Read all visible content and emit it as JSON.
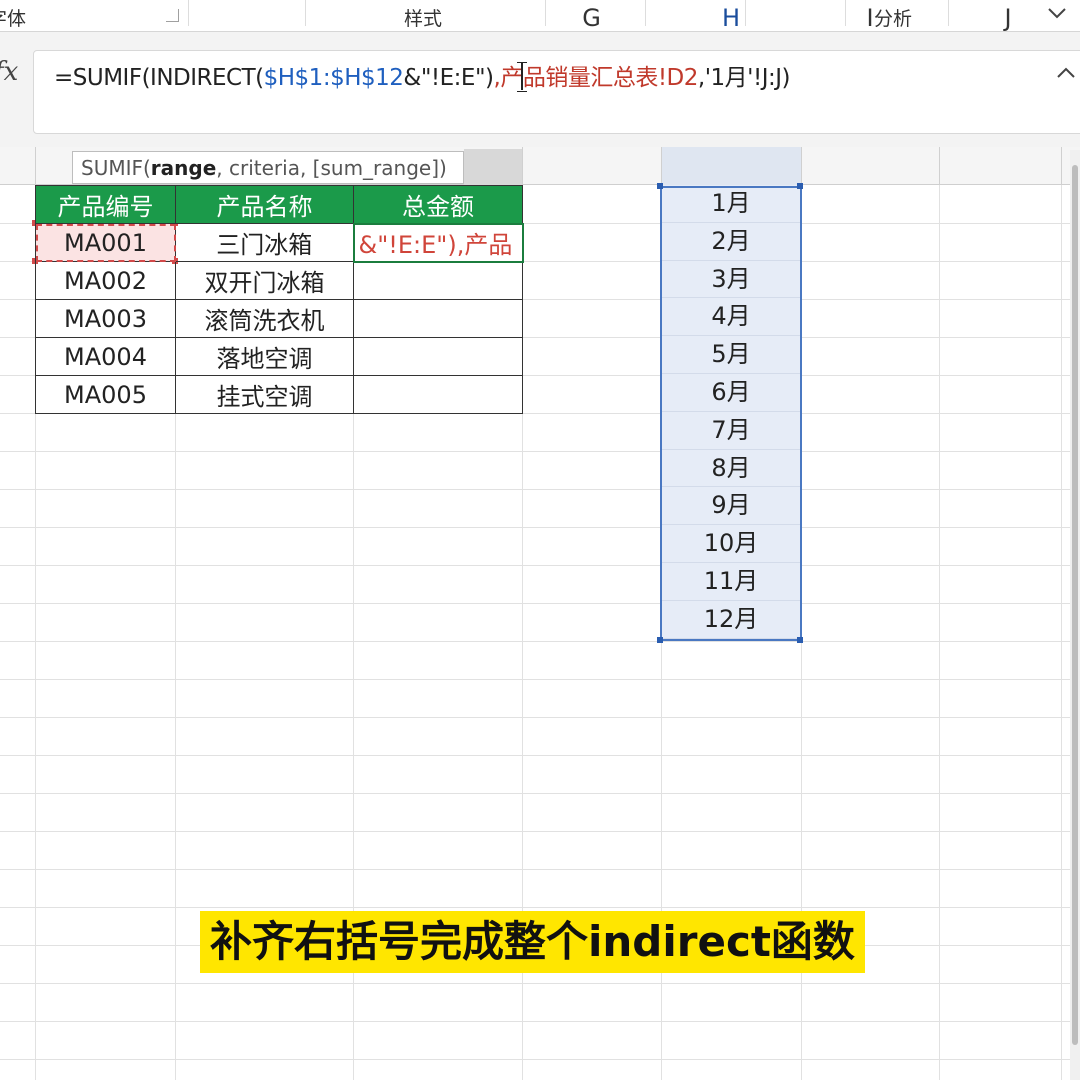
{
  "ribbon": {
    "groups": [
      "字体",
      "样式",
      "分析"
    ],
    "collapse_icon": "chevron-down-icon"
  },
  "formula_bar": {
    "fx_label": "fx",
    "parts": [
      {
        "text": "=SUMIF(INDIRECT(",
        "color": "black"
      },
      {
        "text": "$H$1:$H$12",
        "color": "#1f5fbf"
      },
      {
        "text": "&\"!E:E\")",
        "color": "black"
      },
      {
        "text": ",产品销量汇总表!D2",
        "color": "#c0392b"
      },
      {
        "text": ",'1月'!J:J)",
        "color": "black"
      }
    ]
  },
  "columns": [
    "G",
    "H",
    "I",
    "J"
  ],
  "tooltip": {
    "prefix": "SUMIF(",
    "bold": "range",
    "suffix": ", criteria, [sum_range])"
  },
  "table": {
    "headers": [
      "产品编号",
      "产品名称",
      "总金额"
    ],
    "rows": [
      [
        "MA001",
        "三门冰箱",
        "&\"!E:E\"),产品"
      ],
      [
        "MA002",
        "双开门冰箱",
        ""
      ],
      [
        "MA003",
        "滚筒洗衣机",
        ""
      ],
      [
        "MA004",
        "落地空调",
        ""
      ],
      [
        "MA005",
        "挂式空调",
        ""
      ]
    ]
  },
  "months": [
    "1月",
    "2月",
    "3月",
    "4月",
    "5月",
    "6月",
    "7月",
    "8月",
    "9月",
    "10月",
    "11月",
    "12月"
  ],
  "caption": "补齐右括号完成整个indirect函数",
  "colors": {
    "header_green": "#1b9a4a",
    "selection_blue": "#4a78c2",
    "caption_yellow": "#ffe600",
    "reference_red": "#d34a4a"
  }
}
